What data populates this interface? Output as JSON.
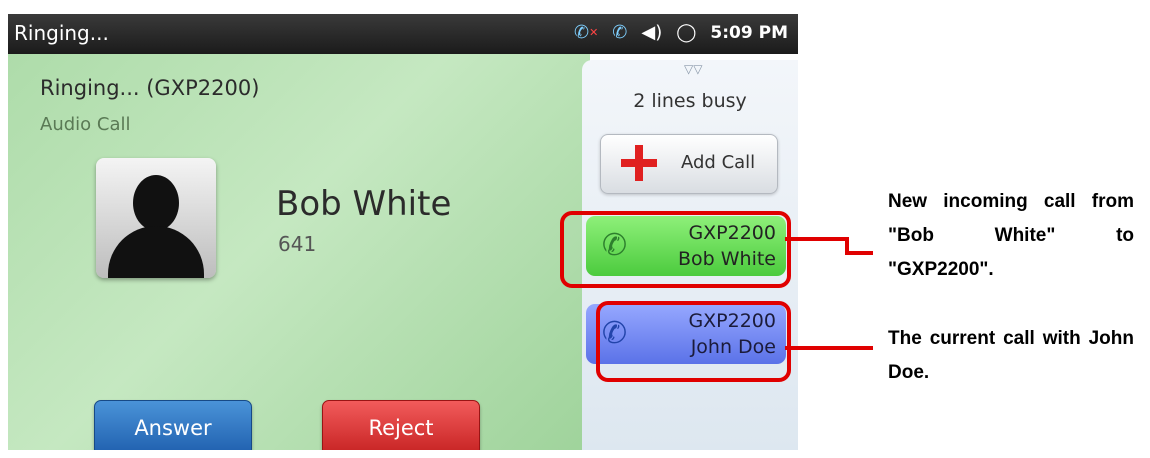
{
  "status_bar": {
    "title": "Ringing...",
    "icons": [
      "missed-call-icon",
      "voicemail-phone-icon",
      "speaker-volume-icon",
      "sync-icon"
    ],
    "time": "5:09 PM"
  },
  "call": {
    "status": "Ringing... (GXP2200)",
    "type": "Audio Call",
    "contact_name": "Bob White",
    "contact_number": "641"
  },
  "buttons": {
    "answer": "Answer",
    "reject": "Reject"
  },
  "side_panel": {
    "lines_busy": "2 lines busy",
    "add_call": "Add Call",
    "lines": [
      {
        "account": "GXP2200",
        "name": "Bob White",
        "color": "#5fd850"
      },
      {
        "account": "GXP2200",
        "name": "John Doe",
        "color": "#6f84f0"
      }
    ]
  },
  "annotations": {
    "incoming": "New incoming call from \"Bob White\" to \"GXP2200\".",
    "current": "The current call with John Doe."
  },
  "colors": {
    "highlight": "#e00000",
    "answer_button": "#2a6fbf",
    "reject_button": "#d93030"
  }
}
